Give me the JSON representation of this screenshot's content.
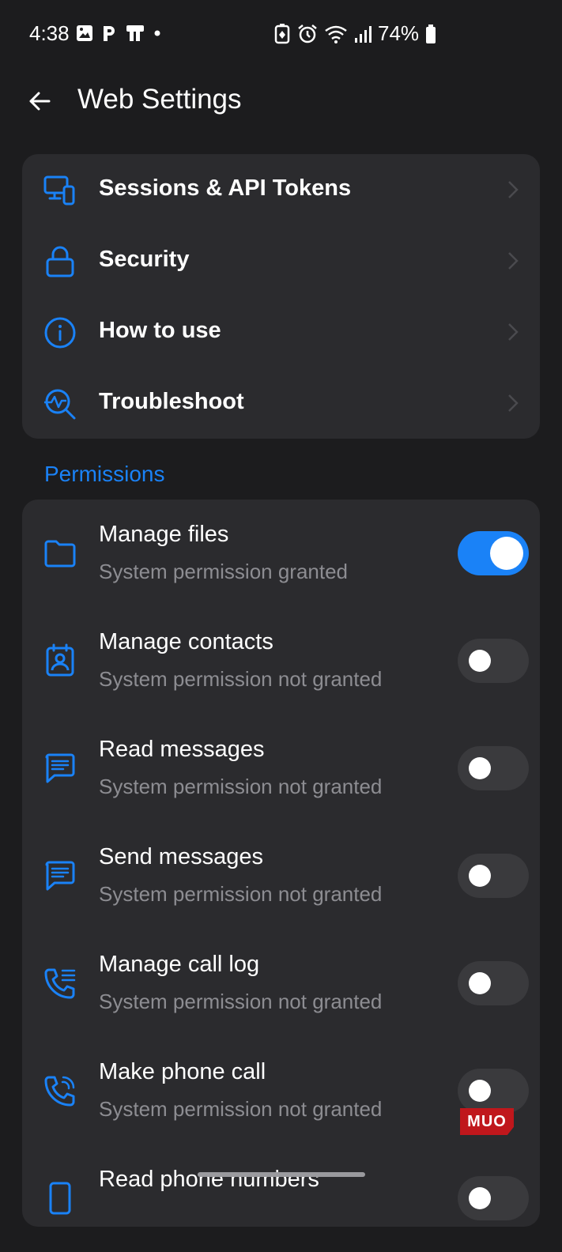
{
  "status_bar": {
    "time": "4:38",
    "battery": "74%"
  },
  "header": {
    "title": "Web Settings"
  },
  "menu": {
    "items": [
      {
        "label": "Sessions & API Tokens",
        "icon": "devices-icon"
      },
      {
        "label": "Security",
        "icon": "lock-icon"
      },
      {
        "label": "How to use",
        "icon": "info-icon"
      },
      {
        "label": "Troubleshoot",
        "icon": "troubleshoot-icon"
      }
    ]
  },
  "permissions": {
    "section_title": "Permissions",
    "items": [
      {
        "title": "Manage files",
        "subtitle": "System permission granted",
        "enabled": true,
        "icon": "folder-icon"
      },
      {
        "title": "Manage contacts",
        "subtitle": "System permission not granted",
        "enabled": false,
        "icon": "contact-icon"
      },
      {
        "title": "Read messages",
        "subtitle": "System permission not granted",
        "enabled": false,
        "icon": "message-icon"
      },
      {
        "title": "Send messages",
        "subtitle": "System permission not granted",
        "enabled": false,
        "icon": "message-icon"
      },
      {
        "title": "Manage call log",
        "subtitle": "System permission not granted",
        "enabled": false,
        "icon": "call-log-icon"
      },
      {
        "title": "Make phone call",
        "subtitle": "System permission not granted",
        "enabled": false,
        "icon": "phone-call-icon"
      },
      {
        "title": "Read phone numbers",
        "subtitle": "",
        "enabled": false,
        "icon": "phone-icon"
      }
    ]
  },
  "watermark": {
    "text": "MUO"
  },
  "colors": {
    "accent": "#1a82f7",
    "background": "#1c1c1e",
    "card": "#2b2b2e",
    "toggle_off": "#3a3a3d",
    "subtitle": "#8d8d92",
    "watermark": "#c0171c"
  }
}
